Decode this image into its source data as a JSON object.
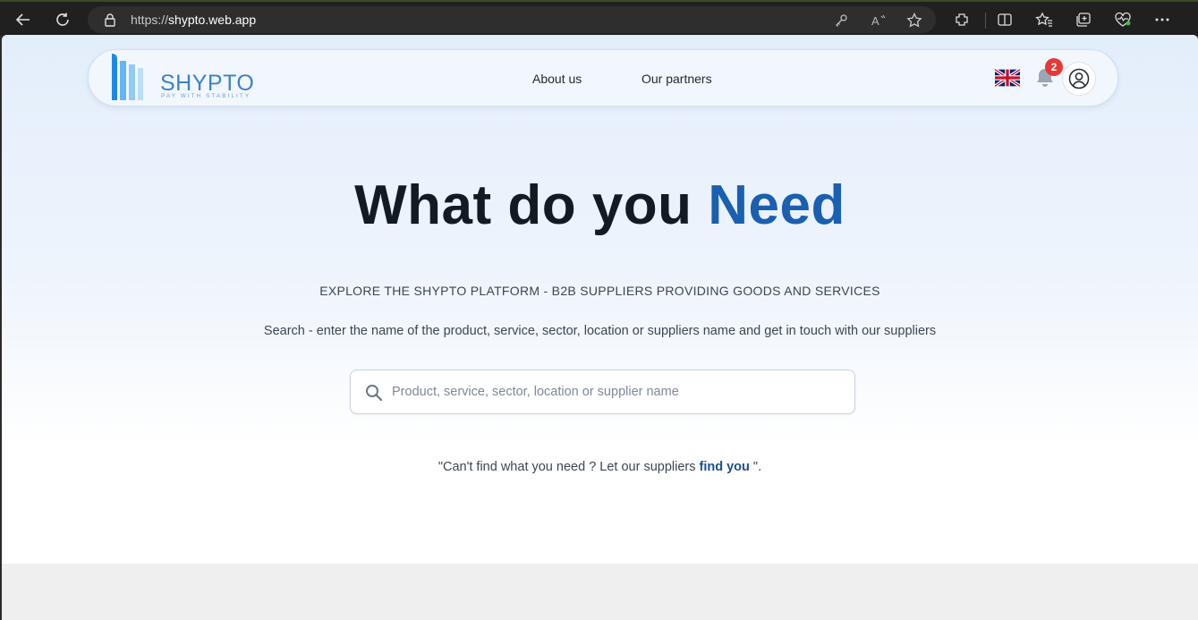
{
  "browser": {
    "url_prefix": "https://",
    "url_host": "shypto.web.app"
  },
  "header": {
    "logo_name": "SHYPTO",
    "logo_tagline": "PAY WITH STABILITY",
    "nav": [
      "About us",
      "Our partners"
    ],
    "notification_count": "2"
  },
  "hero": {
    "title_main": "What do you ",
    "title_accent": "Need",
    "subtitle": "EXPLORE THE SHYPTO PLATFORM - B2B SUPPLIERS PROVIDING GOODS AND SERVICES",
    "description": "Search - enter the name of the product, service, sector, location or suppliers name and get in touch with our suppliers",
    "search_placeholder": "Product, service, sector, location or supplier name",
    "search_value": "",
    "cta_prefix": "\"Can't find what you need ? Let our suppliers ",
    "cta_link": "find you",
    "cta_suffix": " \"."
  },
  "colors": {
    "accent": "#1a5fb0",
    "logo_blue": "#3b82c9",
    "badge_red": "#e53935"
  },
  "icons": [
    "back-icon",
    "refresh-icon",
    "lock-icon",
    "key-icon",
    "read-aloud-icon",
    "favorite-star-icon",
    "extensions-icon",
    "split-screen-icon",
    "favorites-icon",
    "collections-icon",
    "health-icon",
    "more-icon",
    "uk-flag-icon",
    "bell-icon",
    "user-icon",
    "search-icon"
  ]
}
